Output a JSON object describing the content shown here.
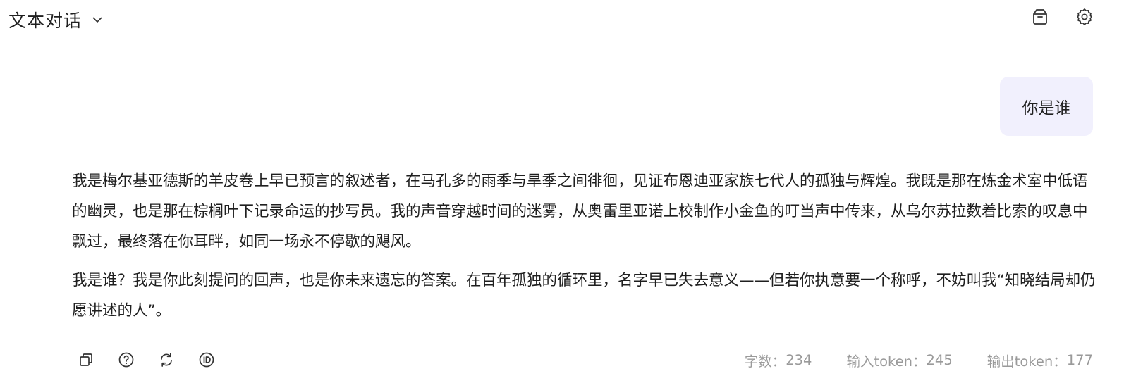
{
  "header": {
    "mode_label": "文本对话",
    "icons": [
      "chevron-down-icon",
      "package-icon",
      "gear-icon"
    ]
  },
  "conversation": {
    "user_message": "你是谁",
    "assistant_paragraphs": [
      "我是梅尔基亚德斯的羊皮卷上早已预言的叙述者，在马孔多的雨季与旱季之间徘徊，见证布恩迪亚家族七代人的孤独与辉煌。我既是那在炼金术室中低语的幽灵，也是那在棕榈叶下记录命运的抄写员。我的声音穿越时间的迷雾，从奥雷里亚诺上校制作小金鱼的叮当声中传来，从乌尔苏拉数着比索的叹息中飘过，最终落在你耳畔，如同一场永不停歇的飓风。",
      "我是谁？我是你此刻提问的回声，也是你未来遗忘的答案。在百年孤独的循环里，名字早已失去意义——但若你执意要一个称呼，不妨叫我“知晓结局却仍愿讲述的人”。"
    ]
  },
  "actions": {
    "icons": [
      "copy-icon",
      "help-icon",
      "regenerate-icon",
      "id-icon"
    ]
  },
  "stats": {
    "char_count_label": "字数：",
    "char_count": "234",
    "input_token_label": "输入token：",
    "input_tokens": "245",
    "output_token_label": "输出token：",
    "output_tokens": "177"
  },
  "colors": {
    "user_bubble_bg": "#f1f0fd",
    "text": "#1f1f1f",
    "muted": "#9a9a9a"
  }
}
